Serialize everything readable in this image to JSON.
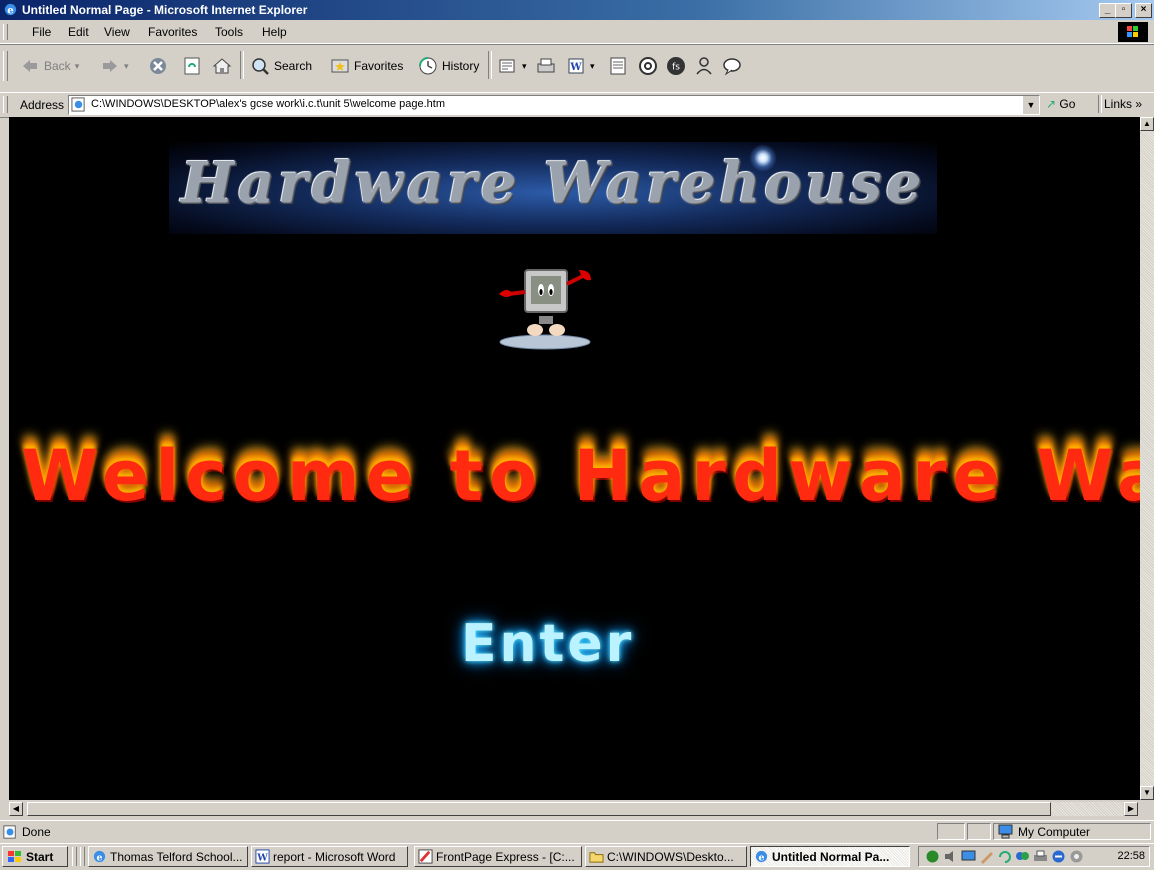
{
  "window": {
    "title": "Untitled Normal Page - Microsoft Internet Explorer",
    "caption_buttons": [
      "minimize",
      "maximize",
      "close"
    ]
  },
  "menu": [
    {
      "label": "File"
    },
    {
      "label": "Edit"
    },
    {
      "label": "View"
    },
    {
      "label": "Favorites"
    },
    {
      "label": "Tools"
    },
    {
      "label": "Help"
    }
  ],
  "toolbar": {
    "back": "Back",
    "search": "Search",
    "favorites": "Favorites",
    "history": "History",
    "icons": [
      "back-arrow-icon",
      "forward-arrow-icon",
      "stop-icon",
      "refresh-icon",
      "home-icon",
      "search-icon",
      "favorites-icon",
      "history-icon",
      "mail-icon",
      "print-icon",
      "edit-word-icon",
      "discuss-icon",
      "messenger-icon",
      "fs-icon",
      "people-icon",
      "chat-bubble-icon"
    ]
  },
  "address": {
    "label": "Address",
    "url": "C:\\WINDOWS\\DESKTOP\\alex's gcse work\\i.c.t\\unit 5\\welcome page.htm",
    "go": "Go",
    "links": "Links »"
  },
  "page": {
    "banner": "Hardware Warehouse",
    "welcome": "Welcome to Hardware Warehouse",
    "enter": "Enter"
  },
  "status": {
    "text": "Done",
    "zone": "My Computer"
  },
  "taskbar": {
    "start": "Start",
    "tasks": [
      {
        "label": "Thomas Telford School..."
      },
      {
        "label": "report - Microsoft Word"
      },
      {
        "label": "FrontPage Express - [C:..."
      },
      {
        "label": "C:\\WINDOWS\\Deskto..."
      },
      {
        "label": "Untitled Normal Pa..."
      }
    ],
    "clock": "22:58"
  }
}
